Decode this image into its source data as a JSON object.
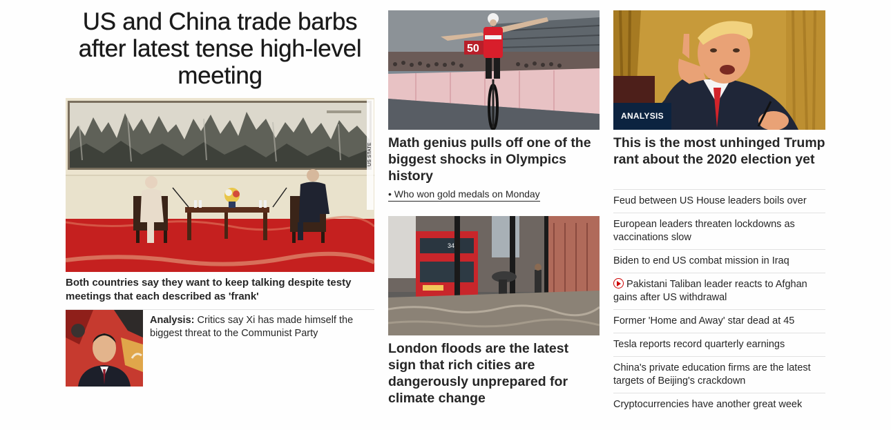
{
  "main_story": {
    "headline": "US and China trade barbs after latest tense high-level meeting",
    "photo_credit": "US STATE DEPARTMENT/UPI/SHUTTERSTOCK",
    "caption": "Both countries say they want to keep talking despite testy meetings that each described as 'frank'",
    "related": {
      "label": "Analysis:",
      "text": "Critics say Xi has made himself the biggest threat to the Communist Party"
    }
  },
  "olympics_story": {
    "headline": "Math genius pulls off one of the biggest shocks in Olympics history",
    "sub_link": "• Who won gold medals on Monday"
  },
  "flood_story": {
    "headline": "London floods are the latest sign that rich cities are dangerously unprepared for climate change"
  },
  "trump_story": {
    "badge": "ANALYSIS",
    "headline": "This is the most unhinged Trump rant about the 2020 election yet"
  },
  "headline_list": [
    {
      "text": "Feud between US House leaders boils over",
      "icon": ""
    },
    {
      "text": "European leaders threaten lockdowns as vaccinations slow",
      "icon": ""
    },
    {
      "text": "Biden to end US combat mission in Iraq",
      "icon": ""
    },
    {
      "text": "Pakistani Taliban leader reacts to Afghan gains after US withdrawal",
      "icon": "video-play-icon"
    },
    {
      "text": "Former 'Home and Away' star dead at 45",
      "icon": ""
    },
    {
      "text": "Tesla reports record quarterly earnings",
      "icon": ""
    },
    {
      "text": "China's private education firms are the latest targets of Beijing's crackdown",
      "icon": ""
    },
    {
      "text": "Cryptocurrencies have another great week",
      "icon": ""
    }
  ],
  "colors": {
    "badge_bg": "#0c2340",
    "video_icon": "#cc0000",
    "text": "#262626"
  }
}
